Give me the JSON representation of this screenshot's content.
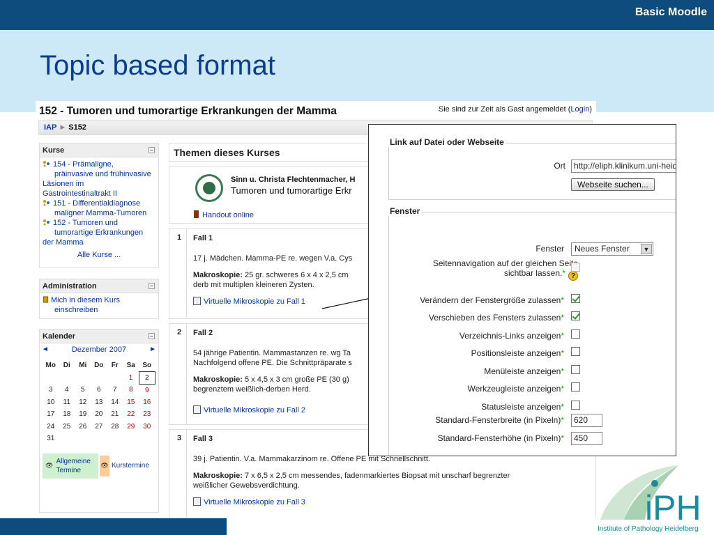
{
  "slide": {
    "brand": "Basic Moodle",
    "title": "Topic based format",
    "logo_text": "iPH",
    "logo_subtitle": "Institute of Pathology Heidelberg"
  },
  "moodle": {
    "course_title": "152 - Tumoren und tumorartige Erkrankungen der Mamma",
    "login_prefix": "Sie sind zur Zeit als Gast angemeldet (",
    "login_link": "Login",
    "login_suffix": ")",
    "breadcrumb": {
      "root": "IAP",
      "sep": "►",
      "current": "S152"
    },
    "courses_block": {
      "title": "Kurse",
      "items": [
        {
          "line1": "154 - Prämaligne,",
          "line2": "präinvasive und frühinvasive",
          "line3": "Läsionen im",
          "line4": "Gastrointestinaltrakt II"
        },
        {
          "line1": "151 - Differentialdiagnose",
          "line2": "maligner Mamma-Tumoren"
        },
        {
          "line1": "152 - Tumoren und",
          "line2": "tumorartige Erkrankungen",
          "line3": "der Mamma"
        }
      ],
      "all_link": "Alle Kurse ..."
    },
    "admin_block": {
      "title": "Administration",
      "enrol_line1": "Mich in diesem Kurs",
      "enrol_line2": "einschreiben"
    },
    "calendar_block": {
      "title": "Kalender",
      "prev": "◄",
      "next": "►",
      "month": "Dezember 2007",
      "weekdays": [
        "Mo",
        "Di",
        "Mi",
        "Do",
        "Fr",
        "Sa",
        "So"
      ],
      "weeks": [
        [
          "",
          "",
          "",
          "",
          "",
          "1",
          "2"
        ],
        [
          "3",
          "4",
          "5",
          "6",
          "7",
          "8",
          "9"
        ],
        [
          "10",
          "11",
          "12",
          "13",
          "14",
          "15",
          "16"
        ],
        [
          "17",
          "18",
          "19",
          "20",
          "21",
          "22",
          "23"
        ],
        [
          "24",
          "25",
          "26",
          "27",
          "28",
          "29",
          "30"
        ],
        [
          "31",
          "",
          "",
          "",
          "",
          "",
          ""
        ]
      ],
      "today": "2",
      "legend_general_line1": "Allgemeine",
      "legend_general_line2": "Termine",
      "legend_course": "Kurstermine"
    },
    "main": {
      "header": "Themen dieses Kurses",
      "intro_authors": "Sinn u. Christa Flechtenmacher, H",
      "intro_course_title": "Tumoren und tumorartige Erkr",
      "handout": "Handout online",
      "sections": [
        {
          "num": "1",
          "title": "Fall 1",
          "text": "17 j. Mädchen. Mamma-PE re. wegen V.a. Cys",
          "makro_label": "Makroskopie:",
          "makro_line1": " 25 gr. schweres 6 x 4 x 2,5 cm",
          "makro_line2": "derb mit multiplen kleineren Zysten.",
          "link": "Virtuelle Mikroskopie zu Fall 1"
        },
        {
          "num": "2",
          "title": "Fall 2",
          "text_line1": "54 jährige Patientin. Mammastanzen re. wg Ta",
          "text_line2": "Nachfolgend offene PE. Die Schnittpräparate s",
          "makro_label": "Makroskopie:",
          "makro_line1": " 5 x 4,5 x 3 cm große PE (30 g)",
          "makro_line2": "begrenztem weißlich-derben Herd.",
          "link": "Virtuelle Mikroskopie zu Fall 2"
        },
        {
          "num": "3",
          "title": "Fall 3",
          "text": "39 j. Patientin. V.a. Mammakarzinom re. Offene PE mit Schnellschnitt.",
          "makro_label": "Makroskopie:",
          "makro_line1": " 7 x 6,5 x 2,5 cm messendes, fadenmarkiertes Biopsat mit unscharf begrenzter",
          "makro_line2": "weißlicher Gewebsverdichtung.",
          "link": "Virtuelle Mikroskopie zu Fall 3"
        }
      ]
    }
  },
  "popup": {
    "link_legend": "Link auf Datei oder Webseite",
    "location_label": "Ort",
    "location_value": "http://eliph.klinikum.uni-heide",
    "search_button": "Webseite suchen...",
    "window_legend": "Fenster",
    "window_label": "Fenster",
    "window_value": "Neues Fenster",
    "rows": [
      {
        "label": "Seitennavigation auf der gleichen Seite",
        "label2": "sichtbar lassen.",
        "checked": false,
        "disabled": true
      },
      {
        "label": "Verändern der Fenstergröße zulassen",
        "checked": true
      },
      {
        "label": "Verschieben des Fensters zulassen",
        "checked": true
      },
      {
        "label": "Verzeichnis-Links anzeigen",
        "checked": false
      },
      {
        "label": "Positionsleiste anzeigen",
        "checked": false
      },
      {
        "label": "Menüleiste anzeigen",
        "checked": false
      },
      {
        "label": "Werkzeugleiste anzeigen",
        "checked": false
      },
      {
        "label": "Statusleiste anzeigen",
        "checked": false
      }
    ],
    "width_label": "Standard-Fensterbreite (in Pixeln)",
    "width_value": "620",
    "height_label": "Standard-Fensterhöhe (in Pixeln)",
    "height_value": "450",
    "asterisk": "*",
    "help": "?"
  },
  "colors": {
    "dark_blue": "#0f4c7e",
    "light_blue": "#cde8f7",
    "title_blue": "#0c3d8c",
    "link_blue": "#0033aa",
    "logo_teal": "#1b8a9a"
  }
}
